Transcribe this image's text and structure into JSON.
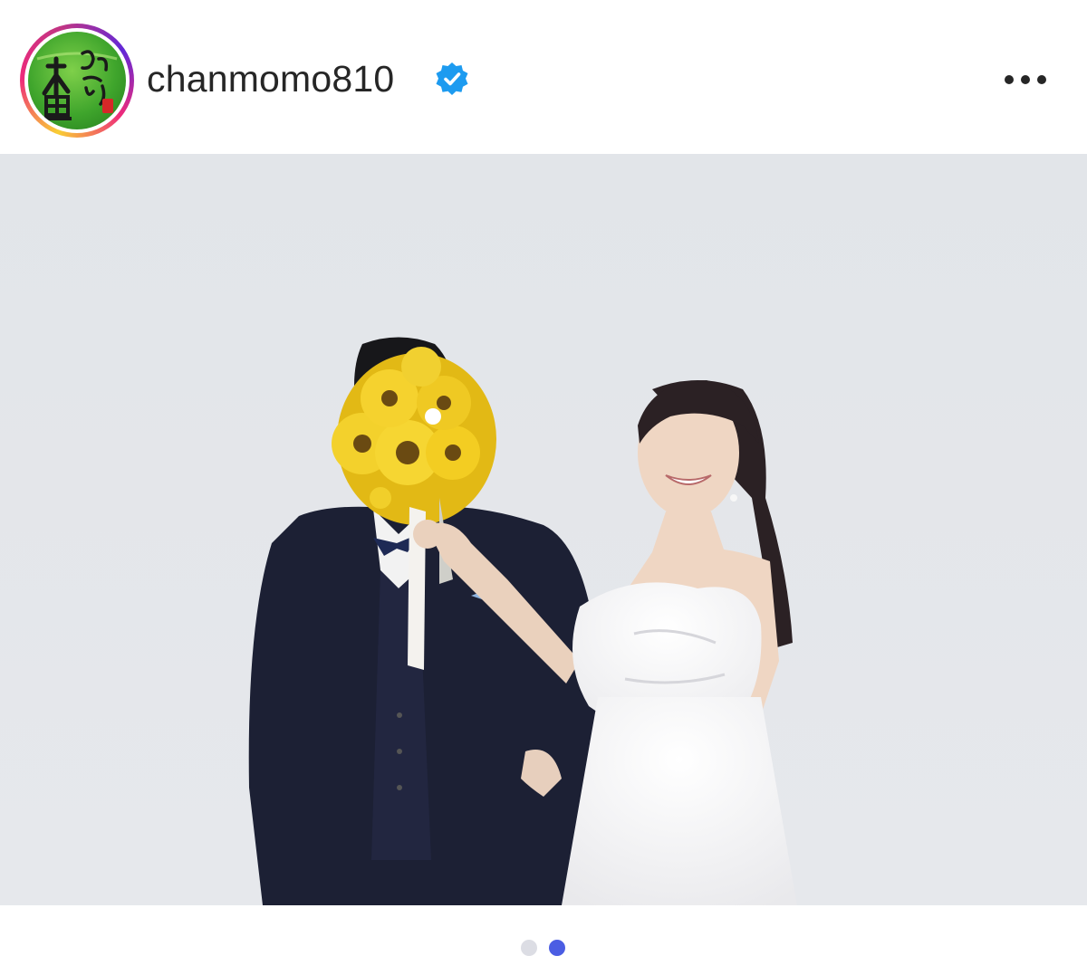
{
  "post": {
    "username": "chanmomo810",
    "verified": true,
    "avatar_icon": "green-tea-logo-icon",
    "avatar_text": "お〜い大里",
    "more_icon": "more-options-icon"
  },
  "photo": {
    "description_icon": "wedding-photo"
  },
  "carousel": {
    "total": 2,
    "active_index": 2,
    "active_color": "#4b5de3",
    "inactive_color": "#dcdde4"
  },
  "colors": {
    "verified_badge": "#1d9bf0",
    "username_text": "#262626"
  }
}
